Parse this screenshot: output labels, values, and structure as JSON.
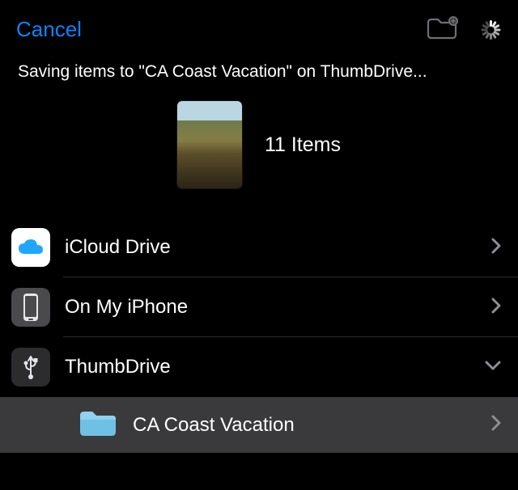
{
  "header": {
    "cancel_label": "Cancel"
  },
  "status_text": "Saving items to \"CA Coast Vacation\" on ThumbDrive...",
  "preview": {
    "count_label": "11 Items"
  },
  "locations": [
    {
      "label": "iCloud Drive",
      "icon": "cloud",
      "expanded": false
    },
    {
      "label": "On My iPhone",
      "icon": "phone",
      "expanded": false
    },
    {
      "label": "ThumbDrive",
      "icon": "usb",
      "expanded": true
    }
  ],
  "selected_folder": {
    "label": "CA Coast Vacation"
  },
  "colors": {
    "accent": "#0a84ff",
    "folder": "#6ec1e4"
  }
}
